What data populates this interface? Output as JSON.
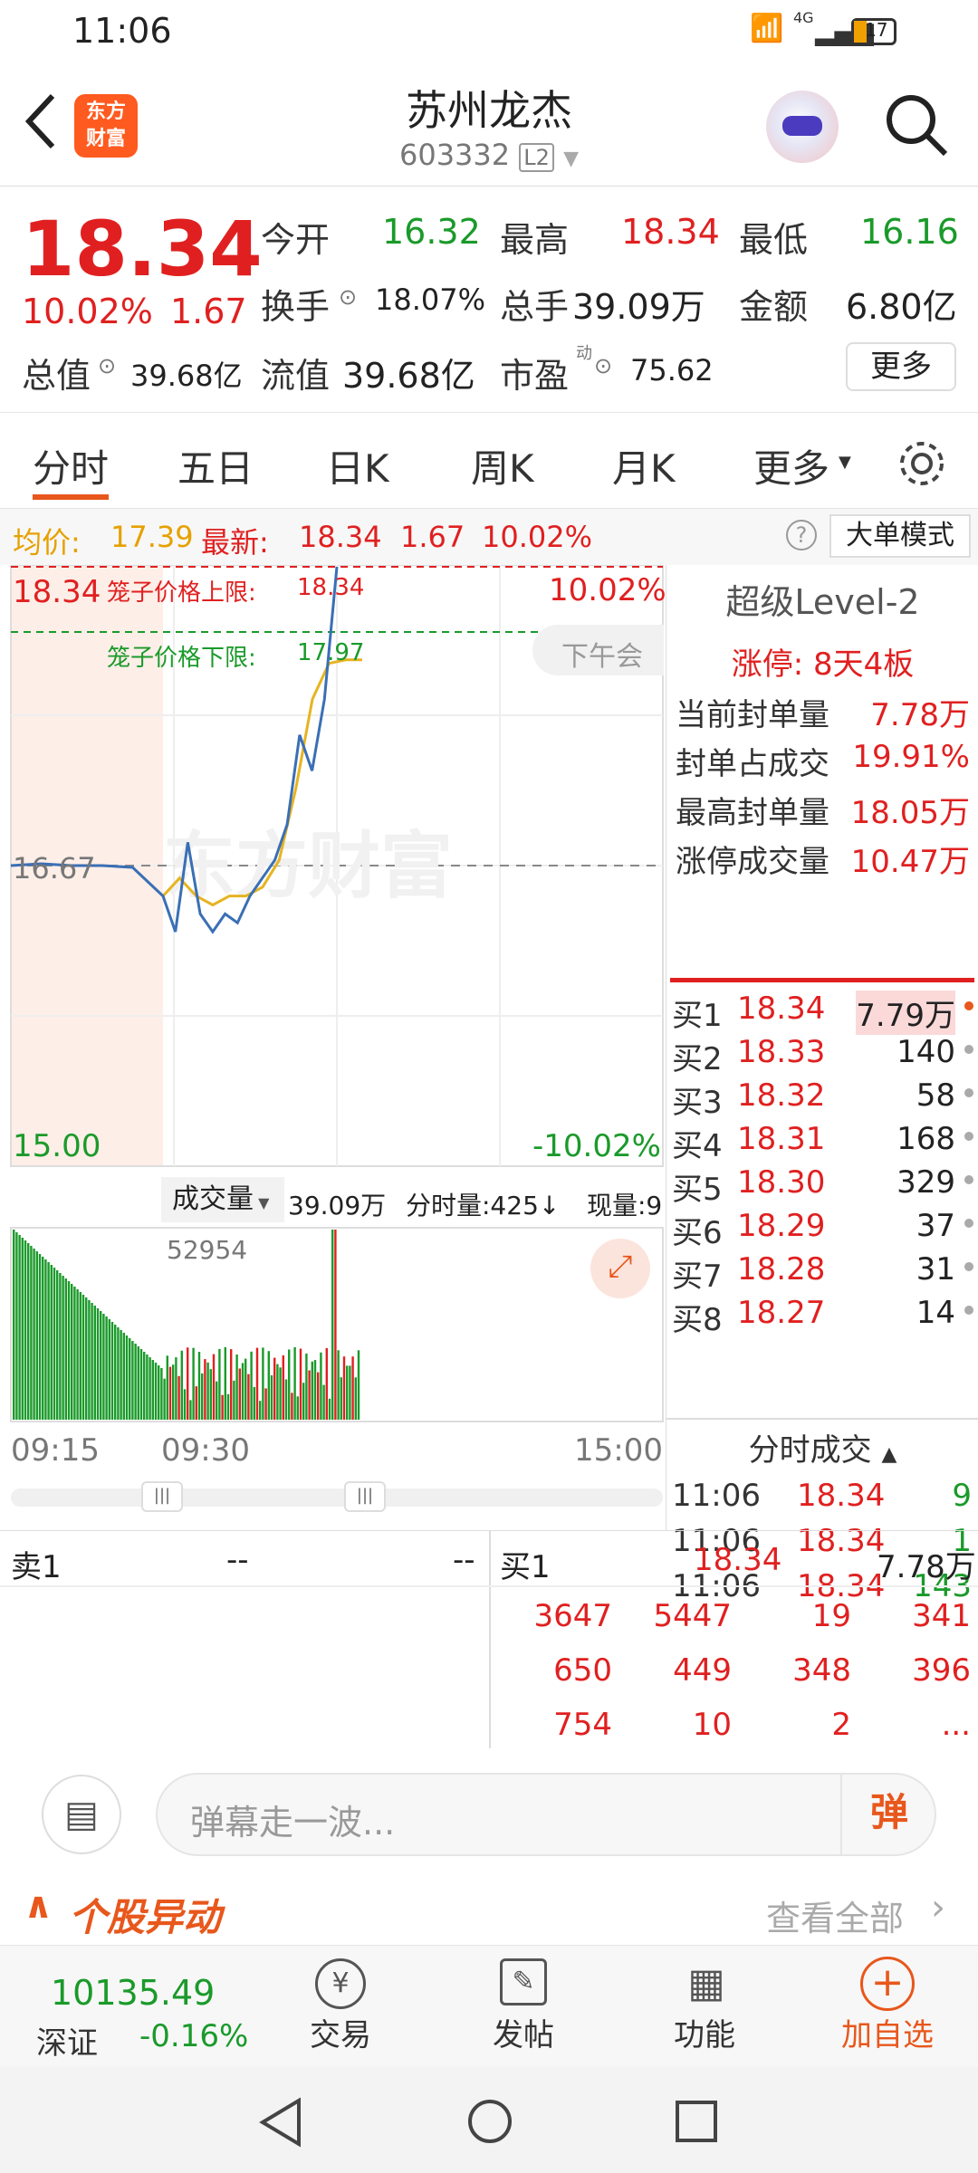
{
  "status": {
    "time": "11:06",
    "battery": "17",
    "network": "4G"
  },
  "nav": {
    "title": "苏州龙杰",
    "code": "603332",
    "level_badge": "L2"
  },
  "quote": {
    "price": "18.34",
    "change_pct": "10.02%",
    "change": "1.67",
    "rows": [
      [
        {
          "label": "今开",
          "value": "16.32",
          "color": "green"
        },
        {
          "label": "最高",
          "value": "18.34",
          "color": "red"
        },
        {
          "label": "最低",
          "value": "16.16",
          "color": "green"
        }
      ],
      [
        {
          "label": "换手",
          "value": "18.07%",
          "color": "dark"
        },
        {
          "label": "总手",
          "value": "39.09万",
          "color": "dark"
        },
        {
          "label": "金额",
          "value": "6.80亿",
          "color": "dark"
        }
      ]
    ],
    "total_value_label": "总值",
    "total_value": "39.68亿",
    "float_value_label": "流值",
    "float_value": "39.68亿",
    "pe_label": "市盈",
    "pe_sup": "动",
    "pe_value": "75.62",
    "more_button": "更多"
  },
  "tabs": {
    "items": [
      "分时",
      "五日",
      "日K",
      "周K",
      "月K",
      "更多"
    ],
    "active": 0
  },
  "infobar": {
    "avg_label": "均价:",
    "avg": "17.39",
    "latest_label": "最新:",
    "latest": "18.34",
    "chg": "1.67",
    "pct": "10.02%",
    "mode_button": "大单模式"
  },
  "chart": {
    "y_top": "18.34",
    "y_mid": "16.67",
    "y_bottom": "15.00",
    "pct_top": "10.02%",
    "pct_bottom": "-10.02%",
    "upper_limit_label": "笼子价格上限:",
    "upper_limit": "18.34",
    "lower_limit_label": "笼子价格下限:",
    "lower_limit": "17.97",
    "session_label": "下午会",
    "watermark": "东方财富",
    "volume_label": "成交量",
    "volume_total": "39.09万",
    "tick_volume": "分时量:425↓",
    "now_volume": "现量:9",
    "volume_max": "52954",
    "time_labels": [
      "09:15",
      "09:30",
      "15:00"
    ]
  },
  "chart_data": {
    "type": "line",
    "title": "",
    "ylim": [
      15.0,
      18.34
    ],
    "series": [
      {
        "values": [
          16.67,
          16.68,
          16.67,
          16.67,
          16.66,
          16.5,
          16.3,
          16.8,
          16.4,
          16.3,
          16.4,
          16.35,
          16.5,
          16.6,
          16.7,
          16.9,
          17.4,
          17.2,
          17.6,
          18.34
        ]
      },
      {
        "values": [
          16.5,
          16.6,
          16.5,
          16.45,
          16.5,
          16.5,
          16.55,
          16.7,
          17.1,
          17.6,
          17.8,
          17.82,
          17.82
        ]
      }
    ],
    "volume_max": 52954
  },
  "level2": {
    "title": "超级Level-2",
    "limit_up": "涨停: 8天4板",
    "stats": [
      {
        "label": "当前封单量",
        "value": "7.78万"
      },
      {
        "label": "封单占成交",
        "value": "19.91%"
      },
      {
        "label": "最高封单量",
        "value": "18.05万"
      },
      {
        "label": "涨停成交量",
        "value": "10.47万"
      }
    ],
    "bids": [
      {
        "label": "买1",
        "price": "18.34",
        "vol": "7.79万"
      },
      {
        "label": "买2",
        "price": "18.33",
        "vol": "140"
      },
      {
        "label": "买3",
        "price": "18.32",
        "vol": "58"
      },
      {
        "label": "买4",
        "price": "18.31",
        "vol": "168"
      },
      {
        "label": "买5",
        "price": "18.30",
        "vol": "329"
      },
      {
        "label": "买6",
        "price": "18.29",
        "vol": "37"
      },
      {
        "label": "买7",
        "price": "18.28",
        "vol": "31"
      },
      {
        "label": "买8",
        "price": "18.27",
        "vol": "14"
      }
    ],
    "ticks_title": "分时成交",
    "ticks": [
      {
        "time": "11:06",
        "price": "18.34",
        "vol": "9"
      },
      {
        "time": "11:06",
        "price": "18.34",
        "vol": "1"
      },
      {
        "time": "11:06",
        "price": "18.34",
        "vol": "143"
      }
    ]
  },
  "depth": {
    "sell_label": "卖1",
    "sell_a": "--",
    "sell_b": "--",
    "buy_label": "买1",
    "buy_price": "18.34",
    "buy_vol": "7.78万",
    "queue": [
      [
        "3647",
        "5447",
        "19",
        "341"
      ],
      [
        "650",
        "449",
        "348",
        "396"
      ],
      [
        "754",
        "10",
        "2",
        "..."
      ]
    ]
  },
  "danmu": {
    "placeholder": "弹幕走一波...",
    "send": "弹"
  },
  "anomaly": {
    "title": "个股异动",
    "view_all": "查看全部"
  },
  "bottom": {
    "index_value": "10135.49",
    "index_name": "深证",
    "index_pct": "-0.16%",
    "trade": "交易",
    "post": "发帖",
    "functions": "功能",
    "add_watch": "加自选"
  }
}
